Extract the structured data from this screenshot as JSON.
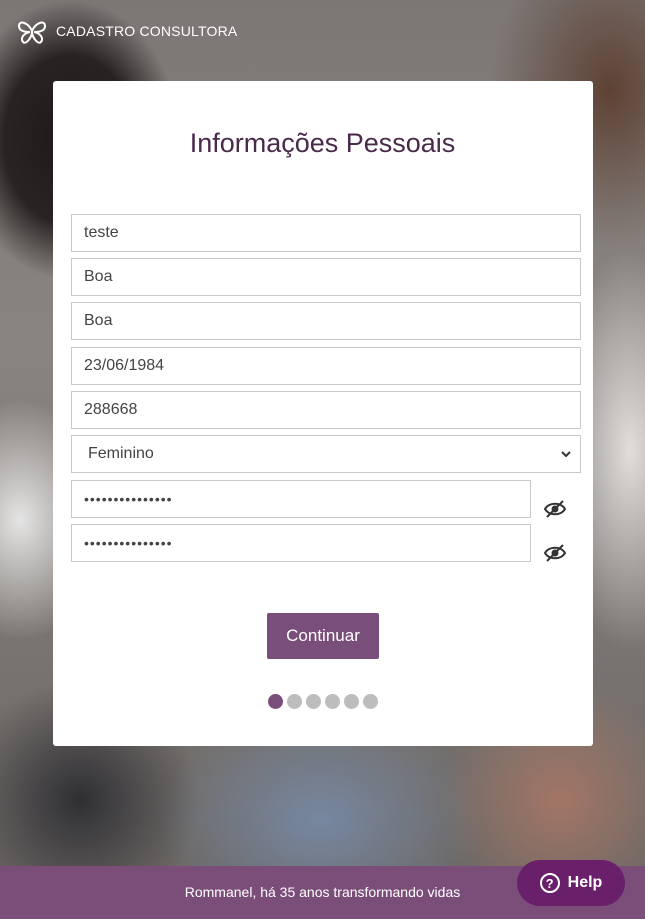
{
  "header": {
    "brand": "CADASTRO CONSULTORA",
    "logo_icon": "butterfly-logo-icon"
  },
  "form": {
    "title": "Informações Pessoais",
    "fields": [
      {
        "value": "teste"
      },
      {
        "value": "Boa"
      },
      {
        "value": "Boa"
      },
      {
        "value": "23/06/1984"
      },
      {
        "value": "288668"
      }
    ],
    "gender": {
      "selected": "Feminino"
    },
    "password": {
      "value": "•••••••••••••••"
    },
    "password_confirm": {
      "value": "•••••••••••••••"
    },
    "continue_label": "Continuar",
    "steps": {
      "total": 6,
      "current": 1
    }
  },
  "footer": {
    "text": "Rommanel, há 35 anos transformando vidas"
  },
  "help": {
    "label": "Help",
    "icon_text": "?"
  },
  "colors": {
    "accent": "#7a4e7a",
    "help_bg": "#6a1f6a",
    "title": "#4a2a4a"
  }
}
